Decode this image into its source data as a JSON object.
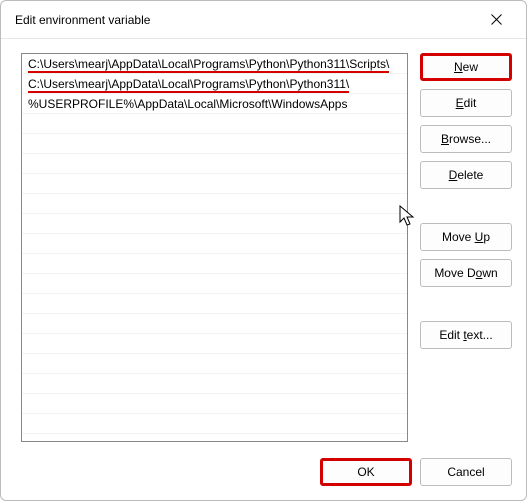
{
  "window": {
    "title": "Edit environment variable"
  },
  "list": {
    "items": [
      "C:\\Users\\mearj\\AppData\\Local\\Programs\\Python\\Python311\\Scripts\\",
      "C:\\Users\\mearj\\AppData\\Local\\Programs\\Python\\Python311\\",
      "%USERPROFILE%\\AppData\\Local\\Microsoft\\WindowsApps"
    ]
  },
  "buttons": {
    "new": {
      "pre": "",
      "u": "N",
      "post": "ew"
    },
    "edit": {
      "pre": "",
      "u": "E",
      "post": "dit"
    },
    "browse": {
      "pre": "",
      "u": "B",
      "post": "rowse..."
    },
    "delete": {
      "pre": "",
      "u": "D",
      "post": "elete"
    },
    "moveup": {
      "pre": "Move ",
      "u": "U",
      "post": "p"
    },
    "movedown": {
      "pre": "Move D",
      "u": "o",
      "post": "wn"
    },
    "edittext": {
      "pre": "Edit ",
      "u": "t",
      "post": "ext..."
    },
    "ok": "OK",
    "cancel": "Cancel"
  }
}
